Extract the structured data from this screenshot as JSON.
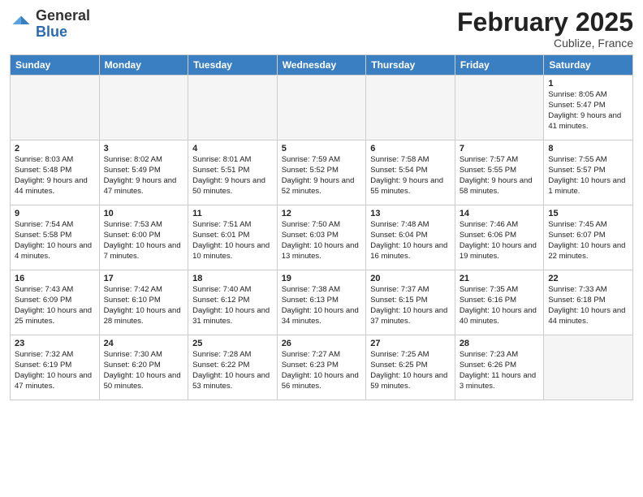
{
  "logo": {
    "general": "General",
    "blue": "Blue"
  },
  "header": {
    "month_year": "February 2025",
    "location": "Cublize, France"
  },
  "weekdays": [
    "Sunday",
    "Monday",
    "Tuesday",
    "Wednesday",
    "Thursday",
    "Friday",
    "Saturday"
  ],
  "weeks": [
    [
      {
        "day": "",
        "info": ""
      },
      {
        "day": "",
        "info": ""
      },
      {
        "day": "",
        "info": ""
      },
      {
        "day": "",
        "info": ""
      },
      {
        "day": "",
        "info": ""
      },
      {
        "day": "",
        "info": ""
      },
      {
        "day": "1",
        "info": "Sunrise: 8:05 AM\nSunset: 5:47 PM\nDaylight: 9 hours and 41 minutes."
      }
    ],
    [
      {
        "day": "2",
        "info": "Sunrise: 8:03 AM\nSunset: 5:48 PM\nDaylight: 9 hours and 44 minutes."
      },
      {
        "day": "3",
        "info": "Sunrise: 8:02 AM\nSunset: 5:49 PM\nDaylight: 9 hours and 47 minutes."
      },
      {
        "day": "4",
        "info": "Sunrise: 8:01 AM\nSunset: 5:51 PM\nDaylight: 9 hours and 50 minutes."
      },
      {
        "day": "5",
        "info": "Sunrise: 7:59 AM\nSunset: 5:52 PM\nDaylight: 9 hours and 52 minutes."
      },
      {
        "day": "6",
        "info": "Sunrise: 7:58 AM\nSunset: 5:54 PM\nDaylight: 9 hours and 55 minutes."
      },
      {
        "day": "7",
        "info": "Sunrise: 7:57 AM\nSunset: 5:55 PM\nDaylight: 9 hours and 58 minutes."
      },
      {
        "day": "8",
        "info": "Sunrise: 7:55 AM\nSunset: 5:57 PM\nDaylight: 10 hours and 1 minute."
      }
    ],
    [
      {
        "day": "9",
        "info": "Sunrise: 7:54 AM\nSunset: 5:58 PM\nDaylight: 10 hours and 4 minutes."
      },
      {
        "day": "10",
        "info": "Sunrise: 7:53 AM\nSunset: 6:00 PM\nDaylight: 10 hours and 7 minutes."
      },
      {
        "day": "11",
        "info": "Sunrise: 7:51 AM\nSunset: 6:01 PM\nDaylight: 10 hours and 10 minutes."
      },
      {
        "day": "12",
        "info": "Sunrise: 7:50 AM\nSunset: 6:03 PM\nDaylight: 10 hours and 13 minutes."
      },
      {
        "day": "13",
        "info": "Sunrise: 7:48 AM\nSunset: 6:04 PM\nDaylight: 10 hours and 16 minutes."
      },
      {
        "day": "14",
        "info": "Sunrise: 7:46 AM\nSunset: 6:06 PM\nDaylight: 10 hours and 19 minutes."
      },
      {
        "day": "15",
        "info": "Sunrise: 7:45 AM\nSunset: 6:07 PM\nDaylight: 10 hours and 22 minutes."
      }
    ],
    [
      {
        "day": "16",
        "info": "Sunrise: 7:43 AM\nSunset: 6:09 PM\nDaylight: 10 hours and 25 minutes."
      },
      {
        "day": "17",
        "info": "Sunrise: 7:42 AM\nSunset: 6:10 PM\nDaylight: 10 hours and 28 minutes."
      },
      {
        "day": "18",
        "info": "Sunrise: 7:40 AM\nSunset: 6:12 PM\nDaylight: 10 hours and 31 minutes."
      },
      {
        "day": "19",
        "info": "Sunrise: 7:38 AM\nSunset: 6:13 PM\nDaylight: 10 hours and 34 minutes."
      },
      {
        "day": "20",
        "info": "Sunrise: 7:37 AM\nSunset: 6:15 PM\nDaylight: 10 hours and 37 minutes."
      },
      {
        "day": "21",
        "info": "Sunrise: 7:35 AM\nSunset: 6:16 PM\nDaylight: 10 hours and 40 minutes."
      },
      {
        "day": "22",
        "info": "Sunrise: 7:33 AM\nSunset: 6:18 PM\nDaylight: 10 hours and 44 minutes."
      }
    ],
    [
      {
        "day": "23",
        "info": "Sunrise: 7:32 AM\nSunset: 6:19 PM\nDaylight: 10 hours and 47 minutes."
      },
      {
        "day": "24",
        "info": "Sunrise: 7:30 AM\nSunset: 6:20 PM\nDaylight: 10 hours and 50 minutes."
      },
      {
        "day": "25",
        "info": "Sunrise: 7:28 AM\nSunset: 6:22 PM\nDaylight: 10 hours and 53 minutes."
      },
      {
        "day": "26",
        "info": "Sunrise: 7:27 AM\nSunset: 6:23 PM\nDaylight: 10 hours and 56 minutes."
      },
      {
        "day": "27",
        "info": "Sunrise: 7:25 AM\nSunset: 6:25 PM\nDaylight: 10 hours and 59 minutes."
      },
      {
        "day": "28",
        "info": "Sunrise: 7:23 AM\nSunset: 6:26 PM\nDaylight: 11 hours and 3 minutes."
      },
      {
        "day": "",
        "info": ""
      }
    ]
  ]
}
